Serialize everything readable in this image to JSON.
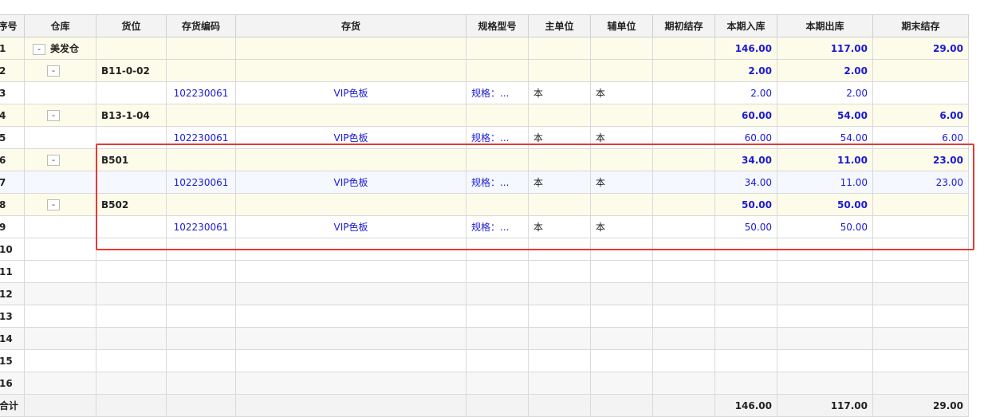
{
  "columns": [
    "序号",
    "仓库",
    "货位",
    "存货编码",
    "存货",
    "规格型号",
    "主单位",
    "辅单位",
    "期初结存",
    "本期入库",
    "本期出库",
    "期末结存"
  ],
  "rows": [
    {
      "seq": "1",
      "type": "group",
      "warehouse": "美发仓",
      "location": "",
      "code": "",
      "item": "",
      "spec": "",
      "unit": "",
      "subunit": "",
      "opening": "",
      "in": "146.00",
      "out": "117.00",
      "closing": "29.00"
    },
    {
      "seq": "2",
      "type": "group",
      "warehouse": "",
      "location": "B11-0-02",
      "code": "",
      "item": "",
      "spec": "",
      "unit": "",
      "subunit": "",
      "opening": "",
      "in": "2.00",
      "out": "2.00",
      "closing": ""
    },
    {
      "seq": "3",
      "type": "detail",
      "warehouse": "",
      "location": "",
      "code": "102230061",
      "item": "VIP色板",
      "spec": "规格：...",
      "unit": "本",
      "subunit": "本",
      "opening": "",
      "in": "2.00",
      "out": "2.00",
      "closing": ""
    },
    {
      "seq": "4",
      "type": "group",
      "warehouse": "",
      "location": "B13-1-04",
      "code": "",
      "item": "",
      "spec": "",
      "unit": "",
      "subunit": "",
      "opening": "",
      "in": "60.00",
      "out": "54.00",
      "closing": "6.00"
    },
    {
      "seq": "5",
      "type": "detail",
      "warehouse": "",
      "location": "",
      "code": "102230061",
      "item": "VIP色板",
      "spec": "规格：...",
      "unit": "本",
      "subunit": "本",
      "opening": "",
      "in": "60.00",
      "out": "54.00",
      "closing": "6.00"
    },
    {
      "seq": "6",
      "type": "group",
      "warehouse": "",
      "location": "B501",
      "code": "",
      "item": "",
      "spec": "",
      "unit": "",
      "subunit": "",
      "opening": "",
      "in": "34.00",
      "out": "11.00",
      "closing": "23.00"
    },
    {
      "seq": "7",
      "type": "detail",
      "warehouse": "",
      "location": "",
      "code": "102230061",
      "item": "VIP色板",
      "spec": "规格：...",
      "unit": "本",
      "subunit": "本",
      "opening": "",
      "in": "34.00",
      "out": "11.00",
      "closing": "23.00"
    },
    {
      "seq": "8",
      "type": "group",
      "warehouse": "",
      "location": "B502",
      "code": "",
      "item": "",
      "spec": "",
      "unit": "",
      "subunit": "",
      "opening": "",
      "in": "50.00",
      "out": "50.00",
      "closing": ""
    },
    {
      "seq": "9",
      "type": "detail",
      "warehouse": "",
      "location": "",
      "code": "102230061",
      "item": "VIP色板",
      "spec": "规格：...",
      "unit": "本",
      "subunit": "本",
      "opening": "",
      "in": "50.00",
      "out": "50.00",
      "closing": ""
    }
  ],
  "empty_rows": [
    "10",
    "11",
    "12",
    "13",
    "14",
    "15",
    "16"
  ],
  "totals": {
    "label": "合计",
    "in": "146.00",
    "out": "117.00",
    "closing": "29.00"
  },
  "toggle_symbol": "-",
  "colors": {
    "highlight_border": "#e53935",
    "group_row_bg": "#fdfbea",
    "value_text": "#1a1ad6"
  }
}
